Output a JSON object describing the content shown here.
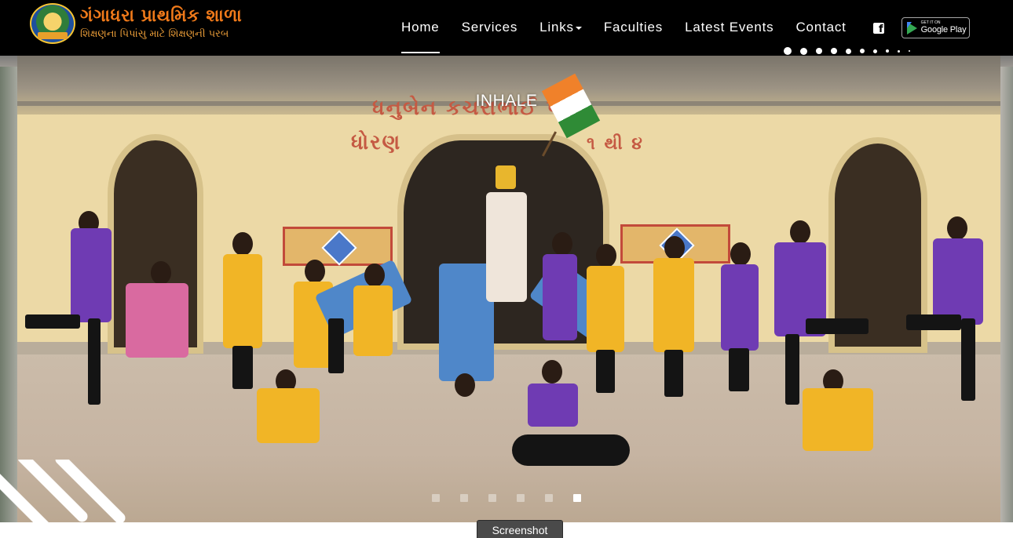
{
  "header": {
    "logo": {
      "title": "ગંગાધરા પ્રાથમિક શાળા",
      "tagline": "શિક્ષણના પિપાંસુ માટે શિક્ષણની પરબ"
    },
    "nav": [
      {
        "label": "Home",
        "active": true
      },
      {
        "label": "Services",
        "active": false
      },
      {
        "label": "Links",
        "active": false,
        "dropdown": true
      },
      {
        "label": "Faculties",
        "active": false
      },
      {
        "label": "Latest Events",
        "active": false
      },
      {
        "label": "Contact",
        "active": false
      }
    ],
    "facebook_icon": "facebook-square-icon",
    "google_play": {
      "small": "GET IT ON",
      "big": "Google Play"
    }
  },
  "slider": {
    "caption": "INHALE",
    "wall_text": {
      "line1": "ધનુબેન કચરાભાઈ પટેલ",
      "line2": "ધોરણ",
      "line3": "૧ થી ૪"
    },
    "top_dots_count": 10,
    "bottom_dots": {
      "count": 6,
      "active_index": 5
    }
  },
  "screenshot_tab": "Screenshot",
  "colors": {
    "header_bg": "#000000",
    "logo_orange": "#f07a1a",
    "uniform_purple": "#6f3bb3",
    "uniform_yellow": "#f1b526",
    "uniform_blue": "#4f87c9"
  }
}
